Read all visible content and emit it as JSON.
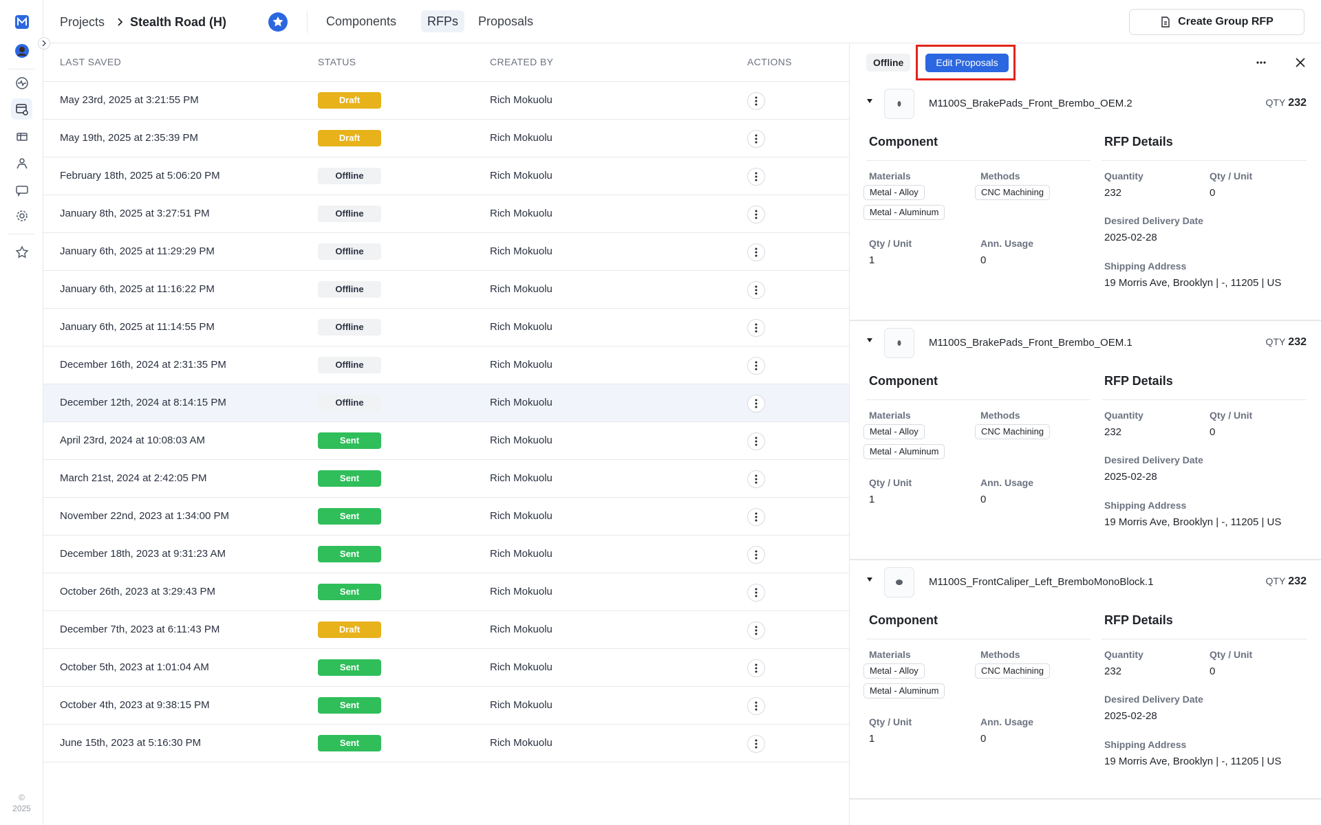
{
  "header": {
    "crumb_projects": "Projects",
    "project_name": "Stealth Road (H)",
    "tabs": [
      "Components",
      "RFPs",
      "Proposals"
    ],
    "create_button": "Create Group RFP"
  },
  "rail": {
    "copyright_symbol": "©",
    "copyright_year": "2025"
  },
  "table": {
    "columns": [
      "LAST SAVED",
      "STATUS",
      "CREATED BY",
      "ACTIONS"
    ],
    "rows": [
      {
        "saved": "May 23rd, 2025 at 3:21:55 PM",
        "status": "Draft",
        "by": "Rich Mokuolu"
      },
      {
        "saved": "May 19th, 2025 at 2:35:39 PM",
        "status": "Draft",
        "by": "Rich Mokuolu"
      },
      {
        "saved": "February 18th, 2025 at 5:06:20 PM",
        "status": "Offline",
        "by": "Rich Mokuolu"
      },
      {
        "saved": "January 8th, 2025 at 3:27:51 PM",
        "status": "Offline",
        "by": "Rich Mokuolu"
      },
      {
        "saved": "January 6th, 2025 at 11:29:29 PM",
        "status": "Offline",
        "by": "Rich Mokuolu"
      },
      {
        "saved": "January 6th, 2025 at 11:16:22 PM",
        "status": "Offline",
        "by": "Rich Mokuolu"
      },
      {
        "saved": "January 6th, 2025 at 11:14:55 PM",
        "status": "Offline",
        "by": "Rich Mokuolu"
      },
      {
        "saved": "December 16th, 2024 at 2:31:35 PM",
        "status": "Offline",
        "by": "Rich Mokuolu"
      },
      {
        "saved": "December 12th, 2024 at 8:14:15 PM",
        "status": "Offline",
        "by": "Rich Mokuolu"
      },
      {
        "saved": "April 23rd, 2024 at 10:08:03 AM",
        "status": "Sent",
        "by": "Rich Mokuolu"
      },
      {
        "saved": "March 21st, 2024 at 2:42:05 PM",
        "status": "Sent",
        "by": "Rich Mokuolu"
      },
      {
        "saved": "November 22nd, 2023 at 1:34:00 PM",
        "status": "Sent",
        "by": "Rich Mokuolu"
      },
      {
        "saved": "December 18th, 2023 at 9:31:23 AM",
        "status": "Sent",
        "by": "Rich Mokuolu"
      },
      {
        "saved": "October 26th, 2023 at 3:29:43 PM",
        "status": "Sent",
        "by": "Rich Mokuolu"
      },
      {
        "saved": "December 7th, 2023 at 6:11:43 PM",
        "status": "Draft",
        "by": "Rich Mokuolu"
      },
      {
        "saved": "October 5th, 2023 at 1:01:04 AM",
        "status": "Sent",
        "by": "Rich Mokuolu"
      },
      {
        "saved": "October 4th, 2023 at 9:38:15 PM",
        "status": "Sent",
        "by": "Rich Mokuolu"
      },
      {
        "saved": "June 15th, 2023 at 5:16:30 PM",
        "status": "Sent",
        "by": "Rich Mokuolu"
      }
    ],
    "selected_row": 8
  },
  "panel": {
    "status_chip": "Offline",
    "edit_button": "Edit Proposals",
    "labels": {
      "component": "Component",
      "rfp_details": "RFP Details",
      "materials": "Materials",
      "methods": "Methods",
      "qty_unit": "Qty / Unit",
      "ann_usage": "Ann. Usage",
      "quantity": "Quantity",
      "desired_delivery": "Desired Delivery Date",
      "shipping_address": "Shipping Address",
      "qty_prefix": "QTY"
    },
    "components": [
      {
        "name": "M1100S_BrakePads_Front_Brembo_OEM.2",
        "qty": "232",
        "materials": [
          "Metal - Alloy",
          "Metal - Aluminum"
        ],
        "methods": [
          "CNC Machining"
        ],
        "qty_unit": "1",
        "ann_usage": "0",
        "quantity": "232",
        "rfp_qty_unit": "0",
        "delivery": "2025-02-28",
        "address": "19 Morris Ave, Brooklyn | -, 11205 | US"
      },
      {
        "name": "M1100S_BrakePads_Front_Brembo_OEM.1",
        "qty": "232",
        "materials": [
          "Metal - Alloy",
          "Metal - Aluminum"
        ],
        "methods": [
          "CNC Machining"
        ],
        "qty_unit": "1",
        "ann_usage": "0",
        "quantity": "232",
        "rfp_qty_unit": "0",
        "delivery": "2025-02-28",
        "address": "19 Morris Ave, Brooklyn | -, 11205 | US"
      },
      {
        "name": "M1100S_FrontCaliper_Left_BremboMonoBlock.1",
        "qty": "232",
        "materials": [
          "Metal - Alloy",
          "Metal - Aluminum"
        ],
        "methods": [
          "CNC Machining"
        ],
        "qty_unit": "1",
        "ann_usage": "0",
        "quantity": "232",
        "rfp_qty_unit": "0",
        "delivery": "2025-02-28",
        "address": "19 Morris Ave, Brooklyn | -, 11205 | US"
      }
    ]
  },
  "colors": {
    "draft": "#e7b21a",
    "sent": "#2fbe5a",
    "offline": "#f1f2f4",
    "primary": "#2b67e0",
    "highlight": "#e3231a"
  }
}
